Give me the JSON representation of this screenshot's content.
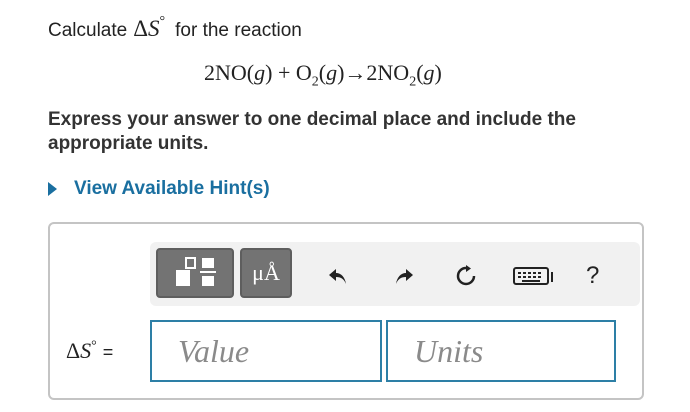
{
  "question": {
    "prefix": "Calculate",
    "symbol_delta": "Δ",
    "symbol_s": "S",
    "symbol_degree": "°",
    "suffix": "for the reaction"
  },
  "equation": {
    "reactant1": "2NO(",
    "reactant1_phase": "g",
    "reactant1_close": ")",
    "plus": "+",
    "reactant2": "O",
    "reactant2_sub": "2",
    "reactant2_phase_open": "(",
    "reactant2_phase": "g",
    "reactant2_phase_close": ")",
    "arrow": "→",
    "product": "2NO",
    "product_sub": "2",
    "product_phase_open": "(",
    "product_phase": "g",
    "product_phase_close": ")"
  },
  "instruction": "Express your answer to one decimal place and include the appropriate units.",
  "hint_link": "View Available Hint(s)",
  "toolbar": {
    "units_label": "μÅ",
    "help_label": "?"
  },
  "answer": {
    "label_delta": "Δ",
    "label_s": "S",
    "label_degree": "°",
    "equals": "=",
    "value_placeholder": "Value",
    "units_placeholder": "Units"
  },
  "icons": [
    "templates-icon",
    "units-icon",
    "undo-icon",
    "redo-icon",
    "reset-icon",
    "keyboard-icon",
    "help-icon"
  ],
  "colors": {
    "link": "#1a6fa0",
    "input_border": "#2d7fa6",
    "toolbar_button": "#737373"
  }
}
